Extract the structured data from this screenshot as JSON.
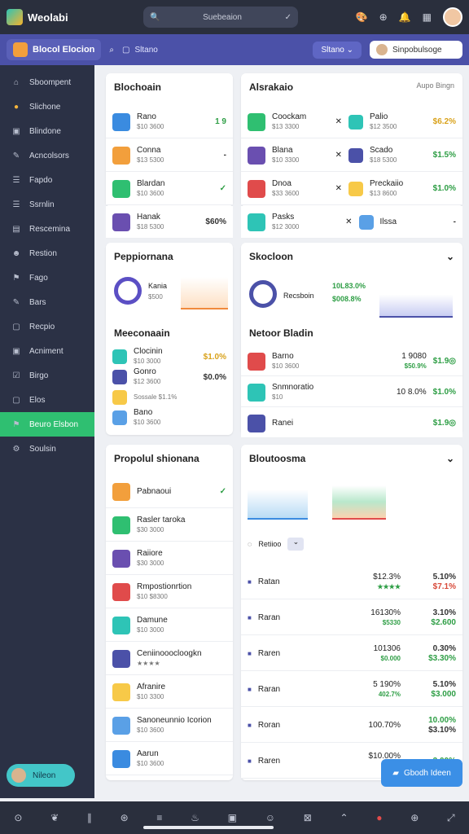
{
  "topbar": {
    "app_name": "Weolabi",
    "search_placeholder": "Suebeaion"
  },
  "subbar": {
    "app_title": "Blocol Elocion",
    "status_label": "Sltano",
    "user_label": "Sinpobulsoge"
  },
  "sidebar": {
    "items": [
      {
        "label": "Sboompent",
        "icon": "home-icon"
      },
      {
        "label": "Slichone",
        "icon": "circle-icon"
      },
      {
        "label": "Blindone",
        "icon": "image-icon"
      },
      {
        "label": "Acncolsors",
        "icon": "pen-icon"
      },
      {
        "label": "Fapdo",
        "icon": "list-icon"
      },
      {
        "label": "Ssrnlin",
        "icon": "list-icon"
      },
      {
        "label": "Rescemina",
        "icon": "doc-icon"
      },
      {
        "label": "Restion",
        "icon": "user-icon"
      },
      {
        "label": "Fago",
        "icon": "tag-icon"
      },
      {
        "label": "Bars",
        "icon": "pen-icon"
      },
      {
        "label": "Recpio",
        "icon": "box-icon"
      },
      {
        "label": "Acniment",
        "icon": "image-icon"
      },
      {
        "label": "Birgo",
        "icon": "check-icon"
      },
      {
        "label": "Elos",
        "icon": "box-icon"
      },
      {
        "label": "Beuro Elsbon",
        "icon": "tag-icon",
        "active": true
      },
      {
        "label": "Soulsin",
        "icon": "gear-icon"
      }
    ],
    "help_label": "Nileon"
  },
  "panels": {
    "p1": {
      "title": "Blochoain",
      "rows": [
        {
          "t": "Rano",
          "s": "$10 3600",
          "v": "1 9",
          "c": "g"
        },
        {
          "t": "Conna",
          "s": "$13 5300",
          "v": "-",
          "c": "k"
        },
        {
          "t": "Blardan",
          "s": "$10 3600",
          "v": "✓",
          "c": "g"
        },
        {
          "t": "Hanak",
          "s": "$18 5300",
          "v": "$60%",
          "c": "k"
        }
      ]
    },
    "p2": {
      "title": "Alsrakaio",
      "action": "Aupo Bingn",
      "rows": [
        {
          "t": "Coockam",
          "s": "$13 3300",
          "t2": "Palio",
          "s2": "$12 3500",
          "v": "$6.2%",
          "c": "o"
        },
        {
          "t": "Blana",
          "s": "$10 3300",
          "t2": "Scado",
          "s2": "$18 5300",
          "v": "$1.5%",
          "c": "g"
        },
        {
          "t": "Dnoa",
          "s": "$33 3600",
          "t2": "Preckaiio",
          "s2": "$13 8600",
          "v": "$1.0%",
          "c": "g"
        },
        {
          "t": "Pasks",
          "s": "$12 3000",
          "t2": "Ilssa",
          "s2": "",
          "v": "-",
          "c": "k"
        }
      ]
    },
    "p3": {
      "title": "Peppiornana",
      "a": {
        "t": "Kania",
        "s": "$500"
      }
    },
    "p4": {
      "title": "Skocloon",
      "a": {
        "t": "Recsboin",
        "s1": "10L83.0%",
        "s2": "$008.8%"
      }
    },
    "p5": {
      "title": "Meeconaain",
      "rows": [
        {
          "t": "Clocinin",
          "s": "$10 3000",
          "v": "$1.0%",
          "c": "o"
        },
        {
          "t": "Gonro",
          "s": "$12 3600",
          "v": "$0.0%",
          "c": "k"
        },
        {
          "t": "",
          "s": "Sossale  $1.1%",
          "v": "",
          "c": "k"
        },
        {
          "t": "Bano",
          "s": "$10 3600",
          "v": "",
          "c": "k"
        }
      ]
    },
    "p6": {
      "title": "Netoor Bladin",
      "rows": [
        {
          "t": "Barno",
          "s": "$10 3600",
          "m": "1 9080",
          "m2": "$50.9%",
          "v": "$1.9◎",
          "c": "g"
        },
        {
          "t": "Snmnoratio",
          "s": "$10",
          "m": "10 8.0%",
          "m2": "",
          "v": "$1.0%",
          "c": "g"
        },
        {
          "t": "Ranei",
          "s": "",
          "m": "",
          "m2": "",
          "v": "$1.9◎",
          "c": "g"
        }
      ]
    },
    "p7": {
      "title": "Propolul shionana",
      "rows": [
        {
          "t": "Pabnaoui",
          "s": "",
          "v": "✓",
          "c": "g"
        },
        {
          "t": "Rasler taroka",
          "s": "$30 3000",
          "v": "",
          "c": "k"
        },
        {
          "t": "Raiiore",
          "s": "$30 3000",
          "v": "",
          "c": "k"
        },
        {
          "t": "Rmpostionrtion",
          "s": "$10 $8300",
          "v": "",
          "c": "k"
        },
        {
          "t": "Damune",
          "s": "$10 3000",
          "v": "",
          "c": "k"
        },
        {
          "t": "Ceniinooocloogkn",
          "s": "★★★★",
          "v": "",
          "c": "k"
        },
        {
          "t": "Afranire",
          "s": "$10 3300",
          "v": "",
          "c": "k"
        },
        {
          "t": "Sanoneunnio Icorion",
          "s": "$10 3600",
          "v": "",
          "c": "k"
        },
        {
          "t": "Aarun",
          "s": "$10 3600",
          "v": "",
          "c": "k"
        }
      ]
    },
    "p8": {
      "title": "Bloutoosma",
      "filter_label": "Retiioo",
      "rows": [
        {
          "t": "Ratan",
          "m": "$12.3%",
          "m2": "★★★★",
          "v": "5.10%",
          "v2": "$7.1%",
          "c": "k",
          "c2": "r"
        },
        {
          "t": "Raran",
          "m": "16130%",
          "m2": "$5330",
          "v": "3.10%",
          "v2": "$2.600",
          "c": "k",
          "c2": "g"
        },
        {
          "t": "Raren",
          "m": "101306",
          "m2": "$0.000",
          "v": "0.30%",
          "v2": "$3.30%",
          "c": "k",
          "c2": "g"
        },
        {
          "t": "Raran",
          "m": "5 190%",
          "m2": "402.7%",
          "v": "5.10%",
          "v2": "$3.000",
          "c": "k",
          "c2": "g"
        },
        {
          "t": "Roran",
          "m": "100.70%",
          "m2": "",
          "v": "10.00%",
          "v2": "$3.10%",
          "c": "g",
          "c2": "k"
        },
        {
          "t": "Raren",
          "m": "$10.00%",
          "m2": "$0.6%",
          "v": "3.00%",
          "v2": "",
          "c": "g",
          "c2": "k"
        }
      ]
    }
  },
  "fab_label": "Gbodh Ideen",
  "colors": {
    "accent": "#4b51a8",
    "active": "#2fbf71",
    "sidebar": "#2b3145"
  }
}
